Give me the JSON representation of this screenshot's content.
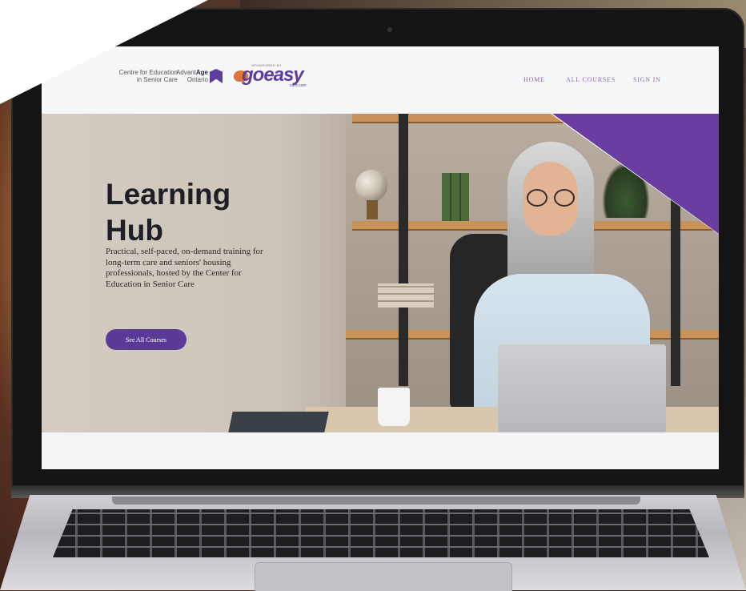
{
  "header": {
    "logo_cess_line1": "Centre for Education",
    "logo_cess_line2": "in Senior Care",
    "logo_adv_prefix": "Advant",
    "logo_adv_bold": "Age",
    "logo_adv_line2": "Ontario",
    "sponsor_label": "SPONSORED BY",
    "sponsor_name": "goeasy",
    "sponsor_sub": "care.com"
  },
  "nav": {
    "items": [
      {
        "label": "HOME"
      },
      {
        "label": "ALL COURSES"
      },
      {
        "label": "SIGN IN"
      }
    ]
  },
  "hero": {
    "title_line1": "Learning",
    "title_line2": "Hub",
    "description": "Practical, self-paced, on-demand training for long-term care and seniors' housing professionals, hosted by the Center for Education in Senior Care",
    "cta_label": "See All Courses"
  },
  "colors": {
    "brand_purple": "#5a3a96",
    "nav_text": "#8a6aa8",
    "title_text": "#1e1e24"
  }
}
